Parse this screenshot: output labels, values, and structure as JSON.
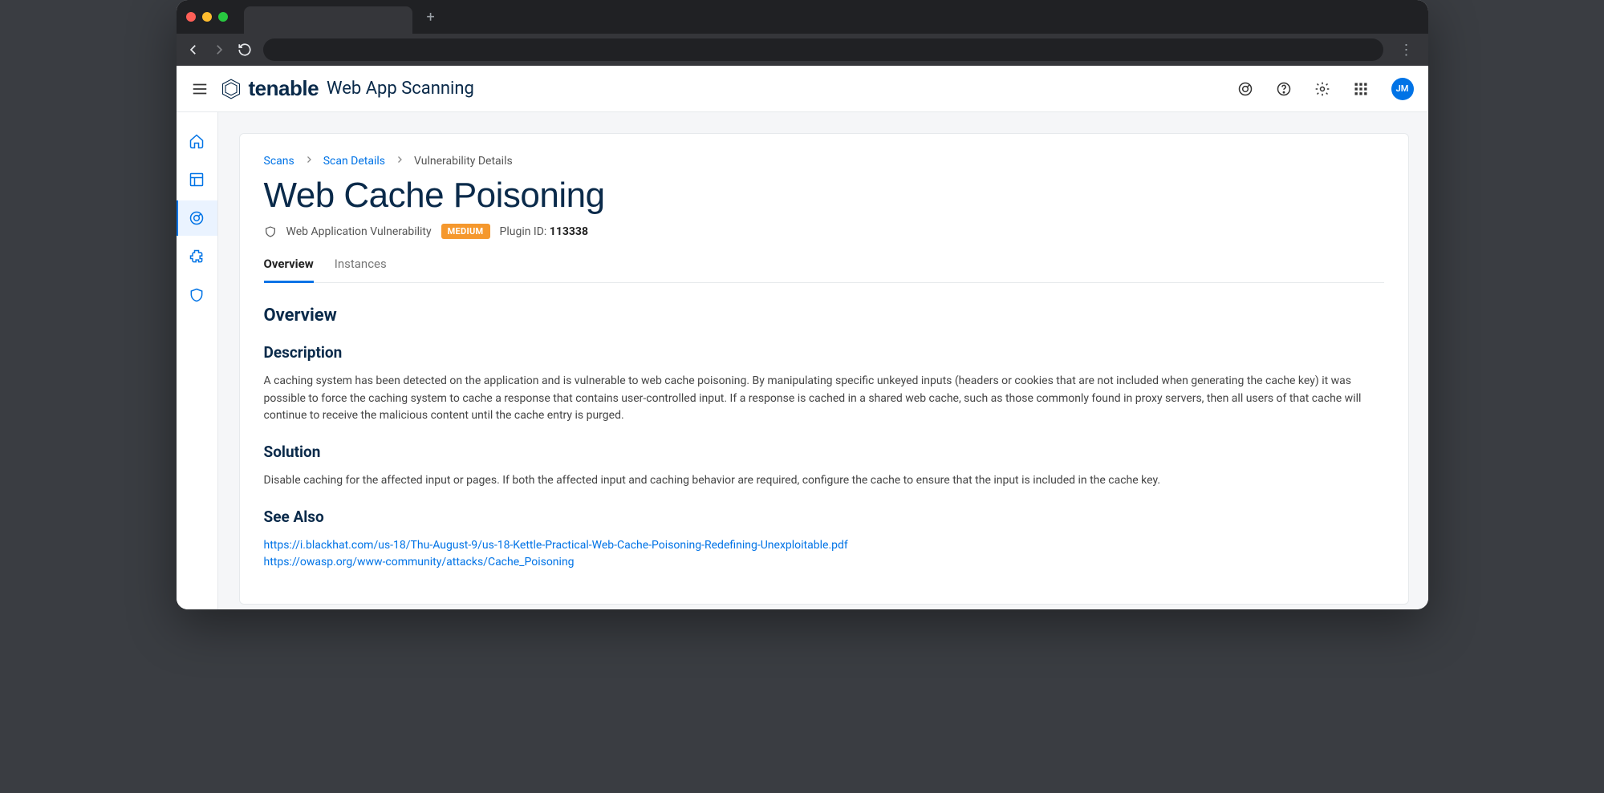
{
  "brand": {
    "name": "tenable",
    "product": "Web App Scanning"
  },
  "avatar": "JM",
  "breadcrumb": {
    "items": [
      "Scans",
      "Scan Details",
      "Vulnerability Details"
    ]
  },
  "page": {
    "title": "Web Cache Poisoning",
    "category": "Web Application Vulnerability",
    "severity": "MEDIUM",
    "plugin_label": "Plugin ID: ",
    "plugin_id": "113338"
  },
  "tabs": [
    "Overview",
    "Instances"
  ],
  "content": {
    "overview_heading": "Overview",
    "description_heading": "Description",
    "description_body": "A caching system has been detected on the application and is vulnerable to web cache poisoning. By manipulating specific unkeyed inputs (headers or cookies that are not included when generating the cache key) it was possible to force the caching system to cache a response that contains user-controlled input. If a response is cached in a shared web cache, such as those commonly found in proxy servers, then all users of that cache will continue to receive the malicious content until the cache entry is purged.",
    "solution_heading": "Solution",
    "solution_body": "Disable caching for the affected input or pages. If both the affected input and caching behavior are required, configure the cache to ensure that the input is included in the cache key.",
    "seealso_heading": "See Also",
    "seealso_links": [
      "https://i.blackhat.com/us-18/Thu-August-9/us-18-Kettle-Practical-Web-Cache-Poisoning-Redefining-Unexploitable.pdf",
      "https://owasp.org/www-community/attacks/Cache_Poisoning"
    ]
  }
}
